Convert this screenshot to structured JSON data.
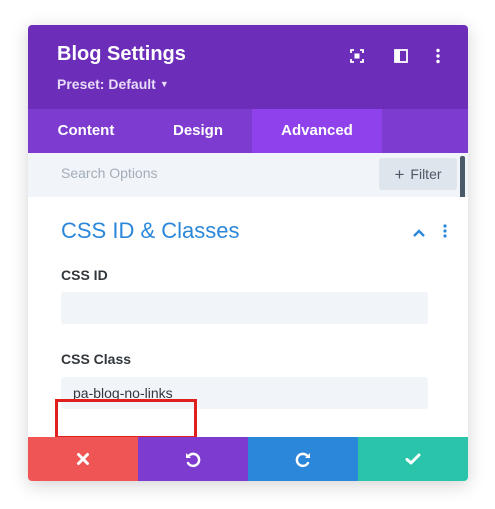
{
  "header": {
    "title": "Blog Settings",
    "preset_label": "Preset: Default",
    "icons": [
      "fullscreen-icon",
      "sidebar-toggle-icon",
      "more-vertical-icon"
    ]
  },
  "tabs": [
    {
      "label": "Content",
      "active": false
    },
    {
      "label": "Design",
      "active": false
    },
    {
      "label": "Advanced",
      "active": true
    }
  ],
  "search": {
    "placeholder": "Search Options",
    "filter_label": "Filter"
  },
  "section": {
    "title": "CSS ID & Classes",
    "fields": [
      {
        "label": "CSS ID",
        "value": ""
      },
      {
        "label": "CSS Class",
        "value": "pa-blog-no-links"
      }
    ]
  },
  "footer": {
    "buttons": [
      "close-icon",
      "undo-icon",
      "redo-icon",
      "check-icon"
    ]
  },
  "colors": {
    "header": "#6c2eb9",
    "tabs": "#7d3bcf",
    "active_tab": "#8f42ec",
    "section_title": "#2b87da",
    "cancel": "#ef5555",
    "undo": "#7e3bd0",
    "redo": "#2b87da",
    "save": "#29c4a9",
    "highlight": "#e01f1f"
  }
}
